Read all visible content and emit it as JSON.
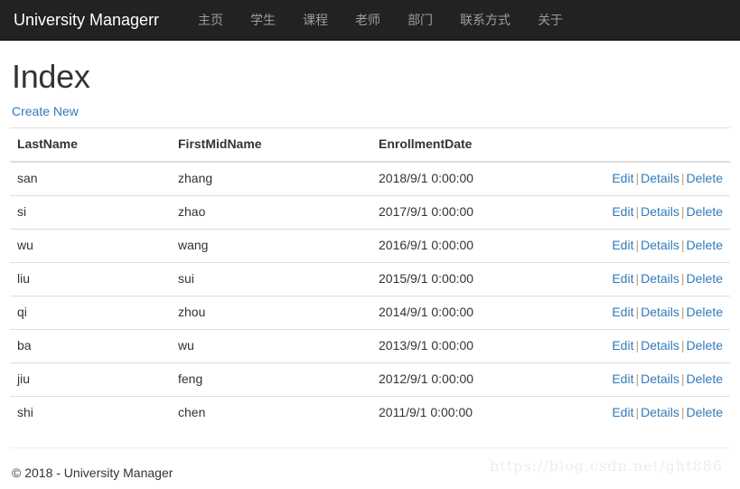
{
  "navbar": {
    "brand": "University Managerr",
    "background_color": "#222222",
    "link_color": "#9d9d9d",
    "items": [
      {
        "label": "主页"
      },
      {
        "label": "学生"
      },
      {
        "label": "课程"
      },
      {
        "label": "老师"
      },
      {
        "label": "部门"
      },
      {
        "label": "联系方式"
      },
      {
        "label": "关于"
      }
    ]
  },
  "main": {
    "title": "Index",
    "create_new_label": "Create New",
    "link_color": "#337ab7",
    "table": {
      "headers": [
        "LastName",
        "FirstMidName",
        "EnrollmentDate",
        ""
      ],
      "actions": {
        "edit": "Edit",
        "details": "Details",
        "delete": "Delete",
        "separator": "|"
      },
      "rows": [
        {
          "last_name": "san",
          "first_mid_name": "zhang",
          "enrollment_date": "2018/9/1 0:00:00"
        },
        {
          "last_name": "si",
          "first_mid_name": "zhao",
          "enrollment_date": "2017/9/1 0:00:00"
        },
        {
          "last_name": "wu",
          "first_mid_name": "wang",
          "enrollment_date": "2016/9/1 0:00:00"
        },
        {
          "last_name": "liu",
          "first_mid_name": "sui",
          "enrollment_date": "2015/9/1 0:00:00"
        },
        {
          "last_name": "qi",
          "first_mid_name": "zhou",
          "enrollment_date": "2014/9/1 0:00:00"
        },
        {
          "last_name": "ba",
          "first_mid_name": "wu",
          "enrollment_date": "2013/9/1 0:00:00"
        },
        {
          "last_name": "jiu",
          "first_mid_name": "feng",
          "enrollment_date": "2012/9/1 0:00:00"
        },
        {
          "last_name": "shi",
          "first_mid_name": "chen",
          "enrollment_date": "2011/9/1 0:00:00"
        }
      ]
    }
  },
  "footer": {
    "copyright": "© 2018 - University Manager",
    "watermark": "https://blog.csdn.net/ght886"
  }
}
